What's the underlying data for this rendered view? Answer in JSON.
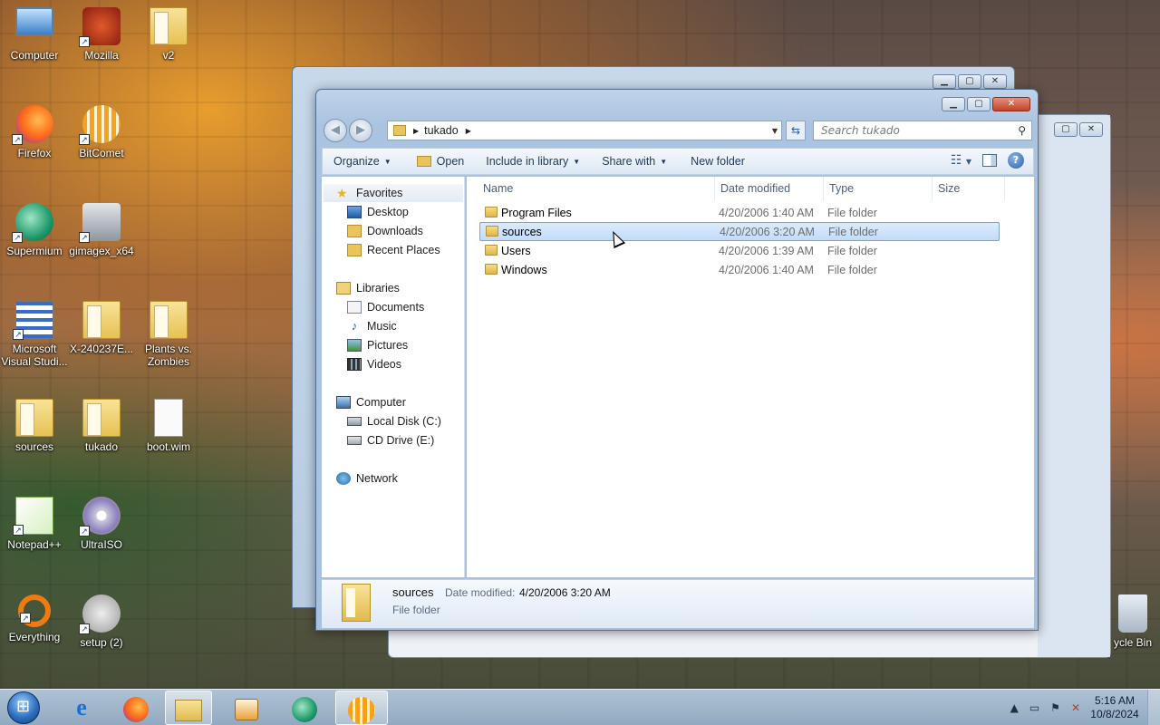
{
  "desktop": {
    "icons": [
      {
        "label": "Computer",
        "icon": "computer-icon"
      },
      {
        "label": "Mozilla",
        "icon": "mozilla-icon"
      },
      {
        "label": "v2",
        "icon": "folder-icon"
      },
      {
        "label": "Firefox",
        "icon": "firefox-icon"
      },
      {
        "label": "BitComet",
        "icon": "bitcomet-icon"
      },
      {
        "label": "Supermium",
        "icon": "supermium-icon"
      },
      {
        "label": "gimagex_x64",
        "icon": "gimagex-icon"
      },
      {
        "label": "Microsoft Visual Studi...",
        "icon": "visual-studio-icon"
      },
      {
        "label": "X-240237E...",
        "icon": "folder-icon"
      },
      {
        "label": "Plants vs. Zombies",
        "icon": "folder-icon"
      },
      {
        "label": "sources",
        "icon": "folder-icon"
      },
      {
        "label": "tukado",
        "icon": "folder-icon"
      },
      {
        "label": "boot.wim",
        "icon": "file-icon"
      },
      {
        "label": "Notepad++",
        "icon": "notepadpp-icon"
      },
      {
        "label": "UltraISO",
        "icon": "ultraiso-icon"
      },
      {
        "label": "Everything",
        "icon": "everything-icon"
      },
      {
        "label": "setup (2)",
        "icon": "setup-icon"
      },
      {
        "label": "ycle Bin",
        "icon": "recycle-bin-icon"
      }
    ]
  },
  "explorer": {
    "address": {
      "path_segment": "tukado"
    },
    "search": {
      "placeholder": "Search tukado"
    },
    "toolbar": {
      "organize": "Organize",
      "open": "Open",
      "include_in_library": "Include in library",
      "share_with": "Share with",
      "new_folder": "New folder"
    },
    "nav": {
      "favorites": "Favorites",
      "desktop": "Desktop",
      "downloads": "Downloads",
      "recent_places": "Recent Places",
      "libraries": "Libraries",
      "documents": "Documents",
      "music": "Music",
      "pictures": "Pictures",
      "videos": "Videos",
      "computer": "Computer",
      "local_disk": "Local Disk (C:)",
      "cd_drive": "CD Drive (E:)",
      "network": "Network"
    },
    "columns": {
      "name": "Name",
      "date": "Date modified",
      "type": "Type",
      "size": "Size"
    },
    "files": [
      {
        "name": "Program Files",
        "date": "4/20/2006 1:40 AM",
        "type": "File folder",
        "selected": false
      },
      {
        "name": "sources",
        "date": "4/20/2006 3:20 AM",
        "type": "File folder",
        "selected": true
      },
      {
        "name": "Users",
        "date": "4/20/2006 1:39 AM",
        "type": "File folder",
        "selected": false
      },
      {
        "name": "Windows",
        "date": "4/20/2006 1:40 AM",
        "type": "File folder",
        "selected": false
      }
    ],
    "details": {
      "name": "sources",
      "date_label": "Date modified:",
      "date_value": "4/20/2006 3:20 AM",
      "type": "File folder"
    }
  },
  "taskbar": {
    "apps": [
      "internet-explorer-icon",
      "firefox-icon",
      "explorer-icon",
      "media-player-icon",
      "supermium-icon",
      "bitcomet-icon"
    ],
    "clock": {
      "time": "5:16 AM",
      "date": "10/8/2024"
    }
  }
}
